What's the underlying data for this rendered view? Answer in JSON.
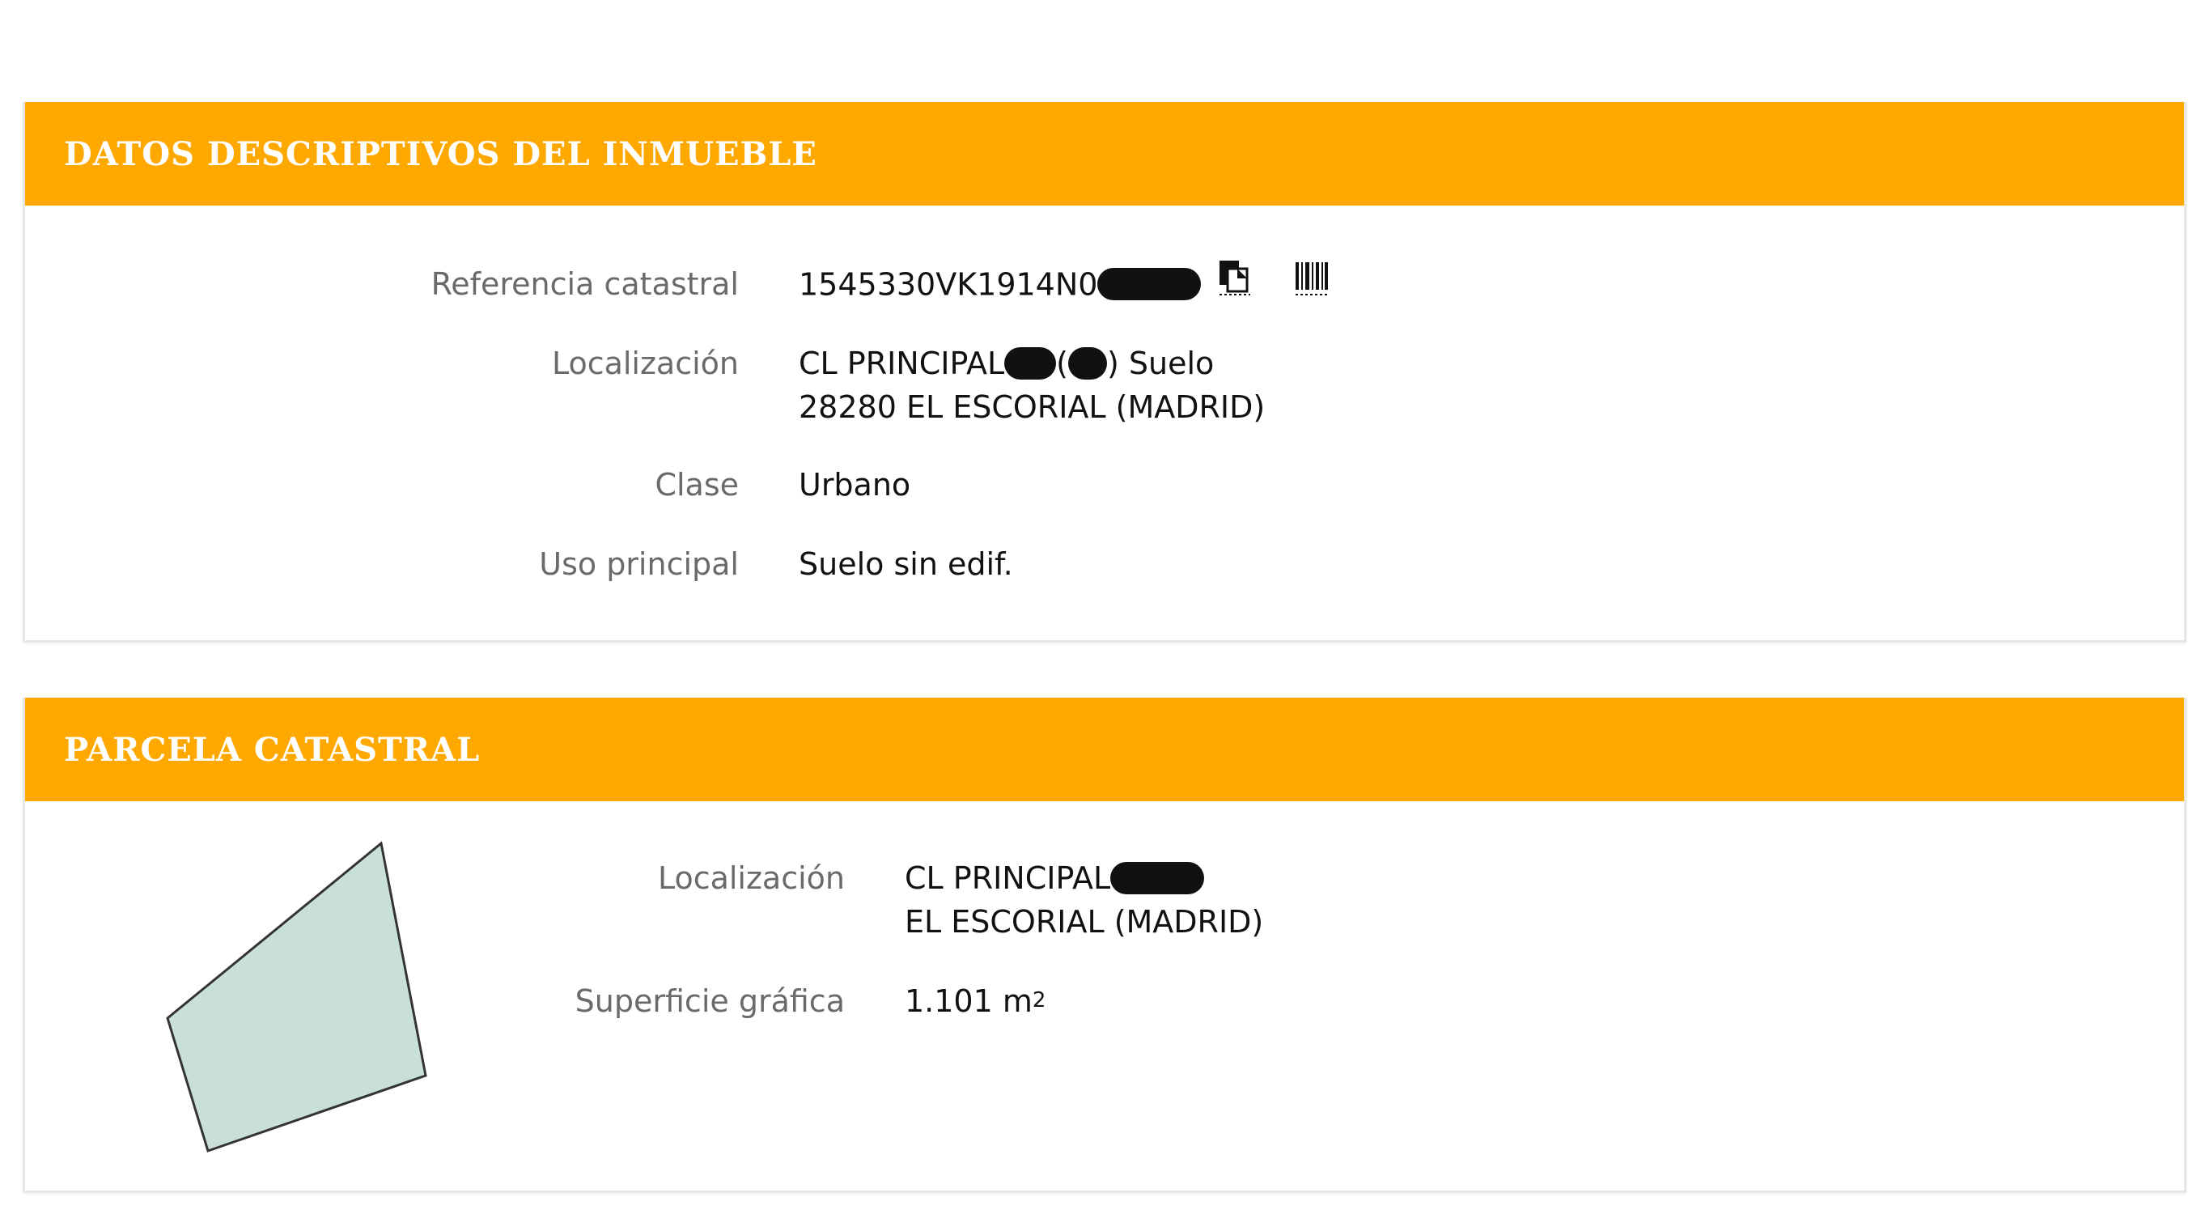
{
  "datos": {
    "title": "DATOS DESCRIPTIVOS DEL INMUEBLE",
    "rows": [
      {
        "label": "Referencia catastral",
        "value": "1545330VK1914N0"
      },
      {
        "label": "Localización",
        "value_line1_a": "CL PRINCIPAL",
        "value_line1_b": "(",
        "value_line1_c": ") Suelo",
        "value_line2": "28280 EL ESCORIAL (MADRID)"
      },
      {
        "label": "Clase",
        "value": "Urbano"
      },
      {
        "label": "Uso principal",
        "value": "Suelo sin edif."
      }
    ]
  },
  "parcela": {
    "title": "PARCELA CATASTRAL",
    "rows": [
      {
        "label": "Localización",
        "value_line1": "CL PRINCIPAL",
        "value_line2": "EL ESCORIAL (MADRID)"
      },
      {
        "label": "Superficie gráfica",
        "value": "1.101 m",
        "unit_sup": "2"
      }
    ],
    "shape_fill": "#c9e0d6",
    "shape_stroke": "#333333"
  },
  "icons": {
    "copy": "copy-icon",
    "barcode": "barcode-icon"
  },
  "colors": {
    "header": "#ffa800",
    "label": "#6a6a6a",
    "value": "#111111"
  }
}
